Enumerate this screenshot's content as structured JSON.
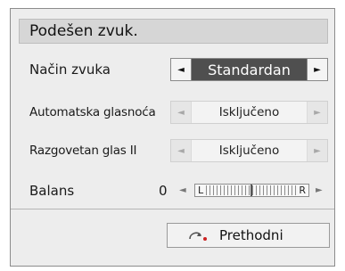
{
  "dialog": {
    "title": "Podešen zvuk."
  },
  "settings": [
    {
      "label": "Način zvuka",
      "value": "Standardan",
      "left_arrow": "◄",
      "right_arrow": "►"
    },
    {
      "label": "Automatska glasnoća",
      "value": "Isključeno",
      "left_arrow": "◄",
      "right_arrow": "►"
    },
    {
      "label": "Razgovetan glas II",
      "value": "Isključeno",
      "left_arrow": "◄",
      "right_arrow": "►"
    }
  ],
  "balance": {
    "label": "Balans",
    "value": "0",
    "left_letter": "L",
    "right_letter": "R",
    "left_arrow": "◄",
    "right_arrow": "►"
  },
  "footer": {
    "prev_label": "Prethodni",
    "prev_icon": "back-return-icon"
  },
  "colors": {
    "panel_bg": "#ededed",
    "title_bg": "#d6d6d6",
    "active_value_bg": "#4f4f4f",
    "active_value_text": "#ffffff"
  }
}
